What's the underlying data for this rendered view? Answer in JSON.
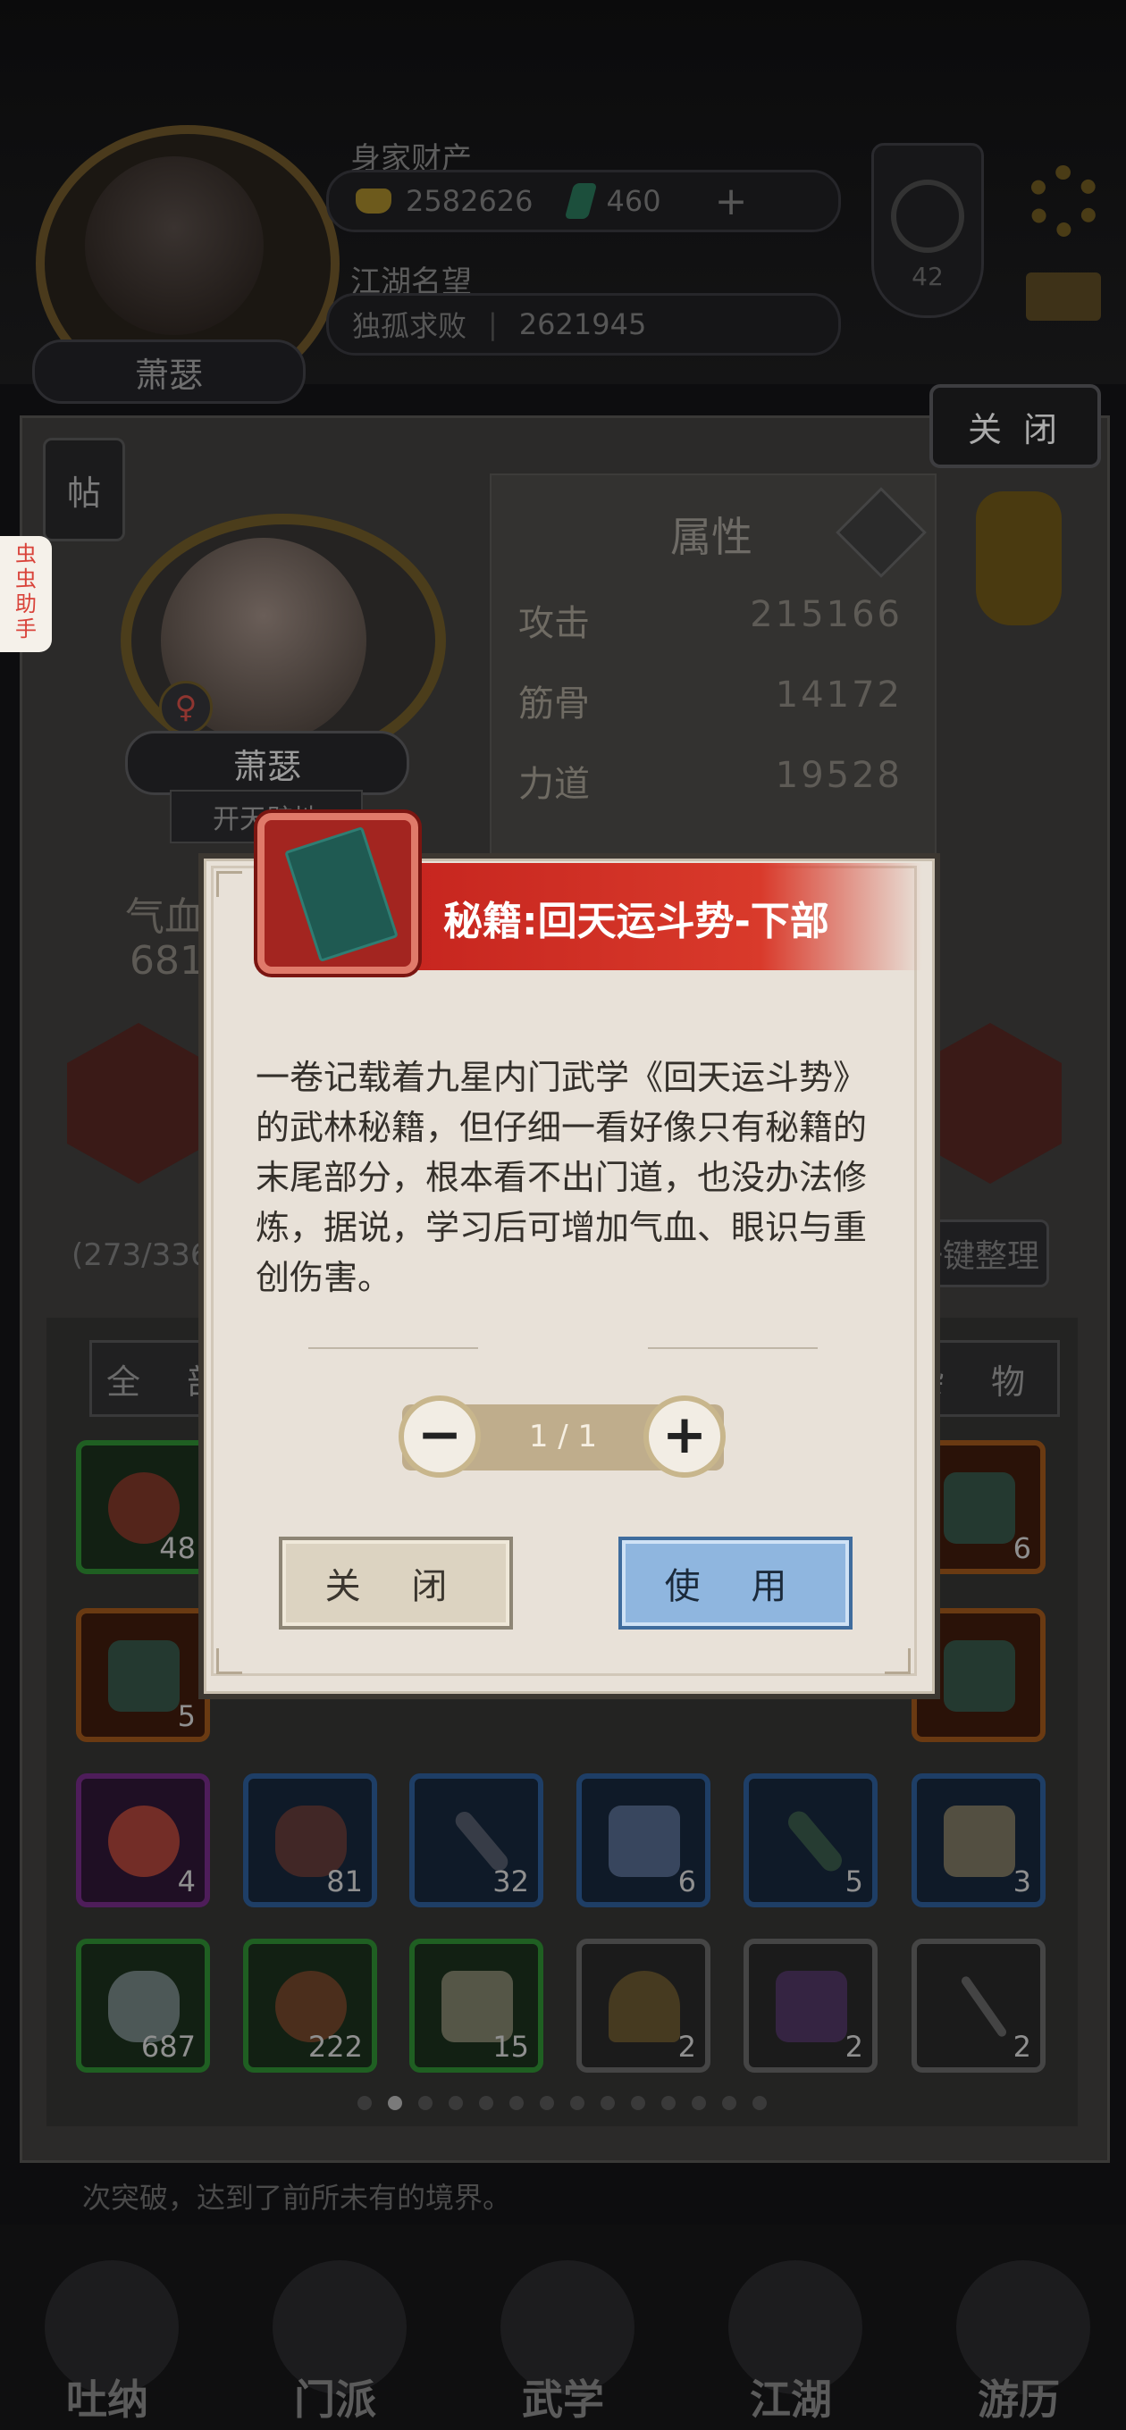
{
  "header": {
    "player_name": "萧瑟",
    "wealth_label": "身家财产",
    "gold": "2582626",
    "jade": "460",
    "fame_label": "江湖名望",
    "fame_title": "独孤求败",
    "fame_value": "2621945",
    "level": "42"
  },
  "panel": {
    "close_label": "关 闭",
    "tie_label": "帖",
    "side_tab": "虫\n虫\n助\n手",
    "character_name": "萧瑟",
    "meridian_label": "开天辟地",
    "gender_symbol": "♀",
    "qixue_label": "气血",
    "qixue_value": "681",
    "attributes_title": "属性",
    "attributes": [
      {
        "name": "攻击",
        "value": "215166"
      },
      {
        "name": "筋骨",
        "value": "14172"
      },
      {
        "name": "力道",
        "value": "19528"
      }
    ],
    "bag_count": "(273/336",
    "tidy_label": "一键整理",
    "filter_all": "全 部",
    "filter_misc": "杂 物",
    "news_text": "次突破，达到了前所未有的境界。"
  },
  "inventory": {
    "row1": [
      {
        "rarity": "g",
        "count": "48"
      },
      {
        "rarity": "o",
        "count": "6"
      }
    ],
    "row2": [
      {
        "rarity": "o",
        "count": "5"
      },
      {
        "rarity": "o",
        "count": ""
      }
    ],
    "row3": [
      {
        "rarity": "p",
        "count": "4"
      },
      {
        "rarity": "b",
        "count": "81"
      },
      {
        "rarity": "b",
        "count": "32"
      },
      {
        "rarity": "b",
        "count": "6"
      },
      {
        "rarity": "b",
        "count": "5"
      },
      {
        "rarity": "b",
        "count": "3"
      }
    ],
    "row4": [
      {
        "rarity": "g",
        "count": "687"
      },
      {
        "rarity": "g",
        "count": "222"
      },
      {
        "rarity": "g",
        "count": "15"
      },
      {
        "rarity": "w",
        "count": "2"
      },
      {
        "rarity": "w",
        "count": "2"
      },
      {
        "rarity": "w",
        "count": "2"
      }
    ],
    "active_page": 2,
    "page_count": 14
  },
  "nav": [
    "吐纳",
    "门派",
    "武学",
    "江湖",
    "游历"
  ],
  "dialog": {
    "title": "秘籍:回天运斗势-下部",
    "description": "一卷记载着九星内门武学《回天运斗势》的武林秘籍，但仔细一看好像只有秘籍的末尾部分，根本看不出门道，也没办法修炼，据说，学习后可增加气血、眼识与重创伤害。",
    "quantity": "1 / 1",
    "minus": "−",
    "plus": "+",
    "close_label": "关 闭",
    "use_label": "使 用"
  },
  "colors": {
    "banner_red": "#c5241e",
    "use_blue": "#8fb6df",
    "dialog_bg": "#e8e1d8"
  }
}
